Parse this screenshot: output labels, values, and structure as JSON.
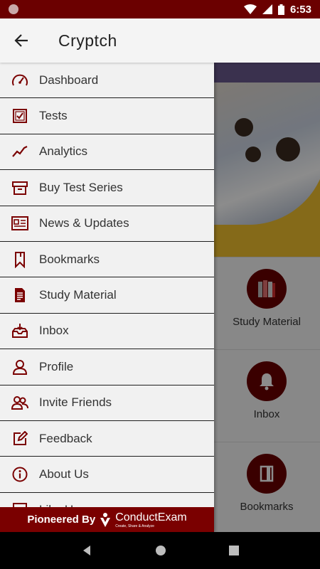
{
  "status_bar": {
    "time": "6:53"
  },
  "app_bar": {
    "title": "Cryptch"
  },
  "drawer": {
    "items": [
      {
        "label": "Dashboard",
        "icon": "speedometer-icon"
      },
      {
        "label": "Tests",
        "icon": "checklist-icon"
      },
      {
        "label": "Analytics",
        "icon": "trend-line-icon"
      },
      {
        "label": "Buy Test Series",
        "icon": "cart-box-icon"
      },
      {
        "label": "News & Updates",
        "icon": "news-icon"
      },
      {
        "label": "Bookmarks",
        "icon": "bookmark-icon"
      },
      {
        "label": "Study Material",
        "icon": "document-icon"
      },
      {
        "label": "Inbox",
        "icon": "inbox-icon"
      },
      {
        "label": "Profile",
        "icon": "person-icon"
      },
      {
        "label": "Invite Friends",
        "icon": "people-icon"
      },
      {
        "label": "Feedback",
        "icon": "pencil-edit-icon"
      },
      {
        "label": "About Us",
        "icon": "info-icon"
      },
      {
        "label": "Like Us",
        "icon": "thumbs-up-icon"
      }
    ],
    "footer": {
      "prefix": "Pioneered By",
      "brand": "ConductExam",
      "tagline": "Create, Share & Analyze"
    }
  },
  "main": {
    "tiles": [
      {
        "label": "Study Material",
        "icon": "books-icon"
      },
      {
        "label": "Inbox",
        "icon": "bell-icon"
      },
      {
        "label": "Bookmarks",
        "icon": "bookmark-book-icon"
      }
    ]
  },
  "colors": {
    "primary": "#6b0000",
    "drawer_bg": "#f1f1f1",
    "accent_yellow": "#f2c12e"
  }
}
